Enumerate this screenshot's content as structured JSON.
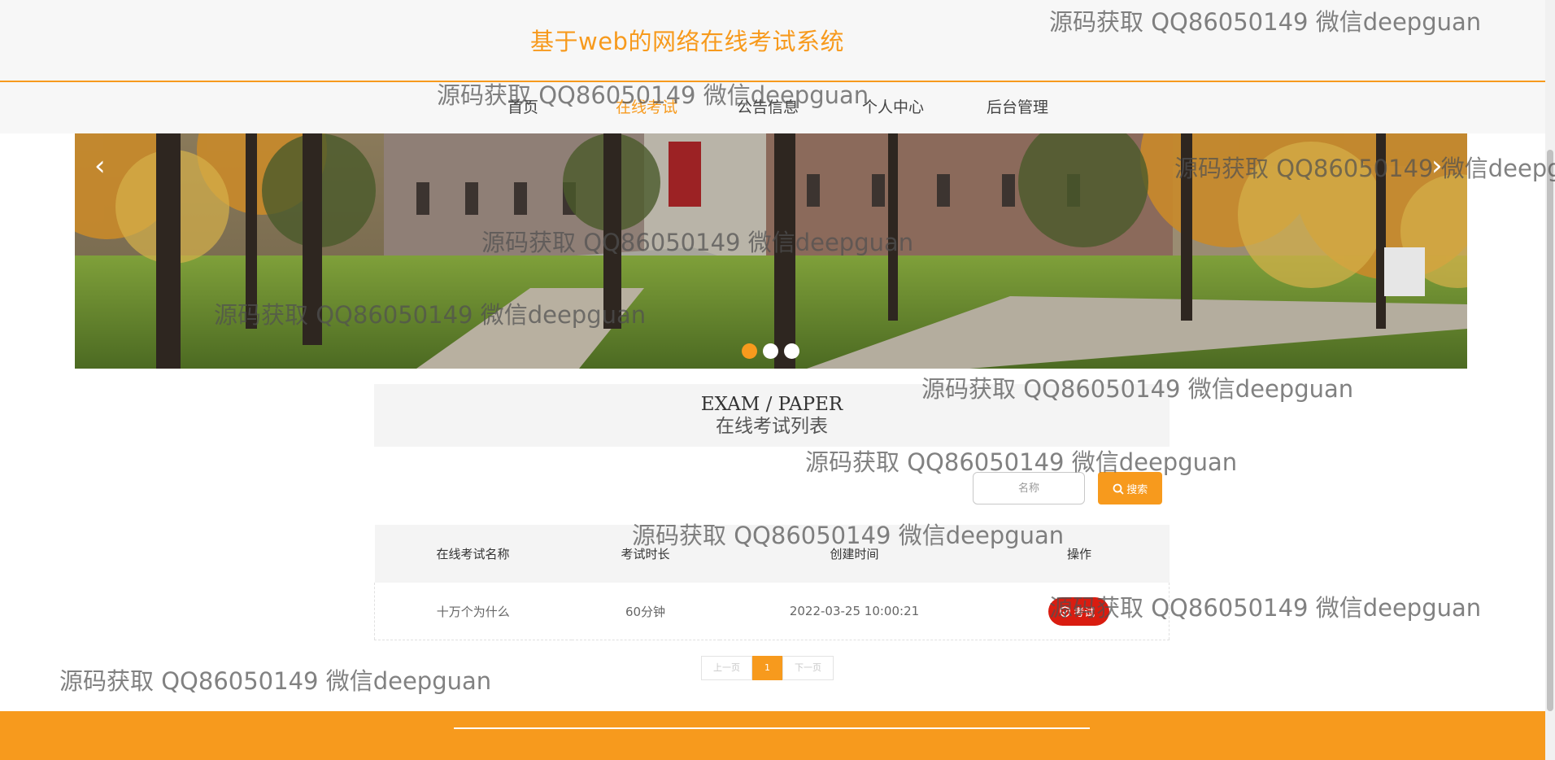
{
  "site": {
    "title": "基于web的网络在线考试系统"
  },
  "nav": {
    "items": [
      {
        "label": "首页"
      },
      {
        "label": "在线考试"
      },
      {
        "label": "公告信息"
      },
      {
        "label": "个人中心"
      },
      {
        "label": "后台管理"
      }
    ],
    "active_index": 1
  },
  "banner": {
    "prev_icon": "‹",
    "next_icon": "›",
    "slide_count": 3,
    "active_slide": 0
  },
  "section": {
    "title_en": "EXAM / PAPER",
    "title_cn": "在线考试列表"
  },
  "search": {
    "placeholder": "名称",
    "button_label": "搜索",
    "button_icon": "search-icon"
  },
  "table": {
    "headers": [
      "在线考试名称",
      "考试时长",
      "创建时间",
      "操作"
    ],
    "rows": [
      {
        "name": "十万个为什么",
        "duration": "60分钟",
        "created": "2022-03-25 10:00:21",
        "action": "考试"
      }
    ]
  },
  "pagination": {
    "prev": "上一页",
    "current": "1",
    "next": "下一页"
  },
  "watermark": {
    "text": "源码获取 QQ86050149 微信deepguan"
  },
  "colors": {
    "accent": "#f79a1d",
    "action_red": "#d91c10",
    "bg_light": "#f7f7f7"
  }
}
